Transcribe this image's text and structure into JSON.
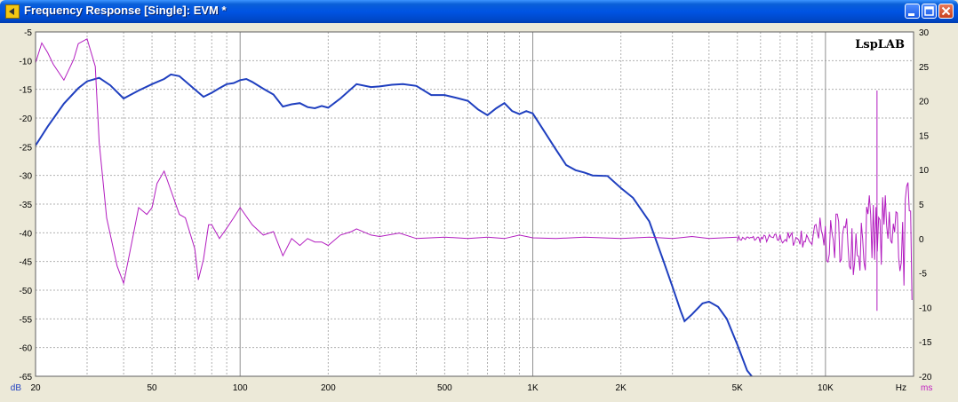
{
  "window": {
    "title": "Frequency Response [Single]: EVM *",
    "controls": [
      "minimize",
      "maximize",
      "close"
    ]
  },
  "brand": "LspLAB",
  "colors": {
    "background": "#ffffff",
    "grid": "#b0b0b0",
    "magnitude": "#1f3fbf",
    "group_delay": "#b21cbf"
  },
  "chart_data": {
    "type": "line",
    "x_scale": "log",
    "xlim": [
      20,
      20000
    ],
    "x_ticks": [
      20,
      50,
      100,
      200,
      500,
      1000,
      2000,
      5000,
      10000
    ],
    "x_tick_labels": [
      "20",
      "50",
      "100",
      "200",
      "500",
      "1K",
      "2K",
      "5K",
      "10K"
    ],
    "xlabel": "Hz",
    "y_left": {
      "unit": "dB",
      "lim": [
        -65,
        -5
      ],
      "ticks": [
        -5,
        -10,
        -15,
        -20,
        -25,
        -30,
        -35,
        -40,
        -45,
        -50,
        -55,
        -60,
        -65
      ]
    },
    "y_right": {
      "unit": "ms",
      "lim": [
        -20,
        30
      ],
      "ticks": [
        30,
        25,
        20,
        15,
        10,
        5,
        0,
        -5,
        -10,
        -15,
        -20
      ]
    },
    "grid": true,
    "series": [
      {
        "axis": "left",
        "x": [
          20,
          22,
          25,
          28,
          30,
          33,
          36,
          40,
          45,
          50,
          55,
          58,
          62,
          70,
          75,
          80,
          85,
          90,
          95,
          100,
          105,
          110,
          120,
          130,
          140,
          150,
          160,
          170,
          180,
          190,
          200,
          220,
          250,
          280,
          300,
          330,
          360,
          400,
          450,
          500,
          550,
          600,
          650,
          700,
          750,
          800,
          850,
          900,
          950,
          1000,
          1100,
          1200,
          1300,
          1400,
          1500,
          1600,
          1800,
          2000,
          2200,
          2500,
          2800,
          3000,
          3200,
          3300,
          3500,
          3800,
          4000,
          4300,
          4600,
          5000,
          5400,
          5700
        ],
        "y": [
          -24.8,
          -21.5,
          -17.5,
          -14.8,
          -13.6,
          -13.0,
          -14.3,
          -16.6,
          -15.2,
          -14.1,
          -13.2,
          -12.4,
          -12.7,
          -15.0,
          -16.3,
          -15.6,
          -14.8,
          -14.1,
          -13.9,
          -13.4,
          -13.2,
          -13.7,
          -14.9,
          -15.9,
          -18.0,
          -17.6,
          -17.4,
          -18.1,
          -18.3,
          -17.9,
          -18.2,
          -16.6,
          -14.1,
          -14.6,
          -14.5,
          -14.2,
          -14.1,
          -14.4,
          -16.0,
          -16.0,
          -16.5,
          -17.0,
          -18.5,
          -19.5,
          -18.3,
          -17.4,
          -18.8,
          -19.3,
          -18.8,
          -19.2,
          -22.5,
          -25.5,
          -28.2,
          -29.1,
          -29.5,
          -30.0,
          -30.1,
          -32.2,
          -33.9,
          -38.0,
          -45.0,
          -49.4,
          -53.6,
          -55.4,
          -54.2,
          -52.3,
          -52.0,
          -52.9,
          -55.0,
          -59.5,
          -64.0,
          -65.5
        ]
      },
      {
        "axis": "right",
        "x": [
          20,
          21,
          22,
          23,
          25,
          27,
          28,
          30,
          32,
          33,
          35,
          38,
          40,
          42,
          45,
          48,
          50,
          52,
          55,
          58,
          62,
          65,
          70,
          72,
          75,
          78,
          80,
          85,
          90,
          95,
          100,
          110,
          120,
          130,
          140,
          150,
          160,
          170,
          180,
          190,
          200,
          220,
          240,
          250,
          280,
          300,
          350,
          400,
          500,
          600,
          700,
          800,
          900,
          1000,
          1200,
          1500,
          2000,
          2500,
          3000,
          3500,
          4000,
          5000
        ],
        "y": [
          25.5,
          28.4,
          27.0,
          25.3,
          23.0,
          26.0,
          28.3,
          29.0,
          25.0,
          14.0,
          3.0,
          -4.0,
          -6.5,
          -2.0,
          4.5,
          3.5,
          4.5,
          8.0,
          9.8,
          7.0,
          3.5,
          3.0,
          -1.5,
          -6.0,
          -3.0,
          2.0,
          2.0,
          0.0,
          1.5,
          3.0,
          4.5,
          2.0,
          0.5,
          1.0,
          -2.5,
          0.0,
          -1.0,
          0.0,
          -0.5,
          -0.5,
          -1.0,
          0.5,
          1.0,
          1.4,
          0.5,
          0.3,
          0.8,
          0.0,
          0.2,
          0.0,
          0.2,
          0.0,
          0.5,
          0.1,
          0.0,
          0.2,
          0.0,
          0.2,
          0.0,
          0.3,
          0.0,
          0.2
        ]
      }
    ]
  }
}
